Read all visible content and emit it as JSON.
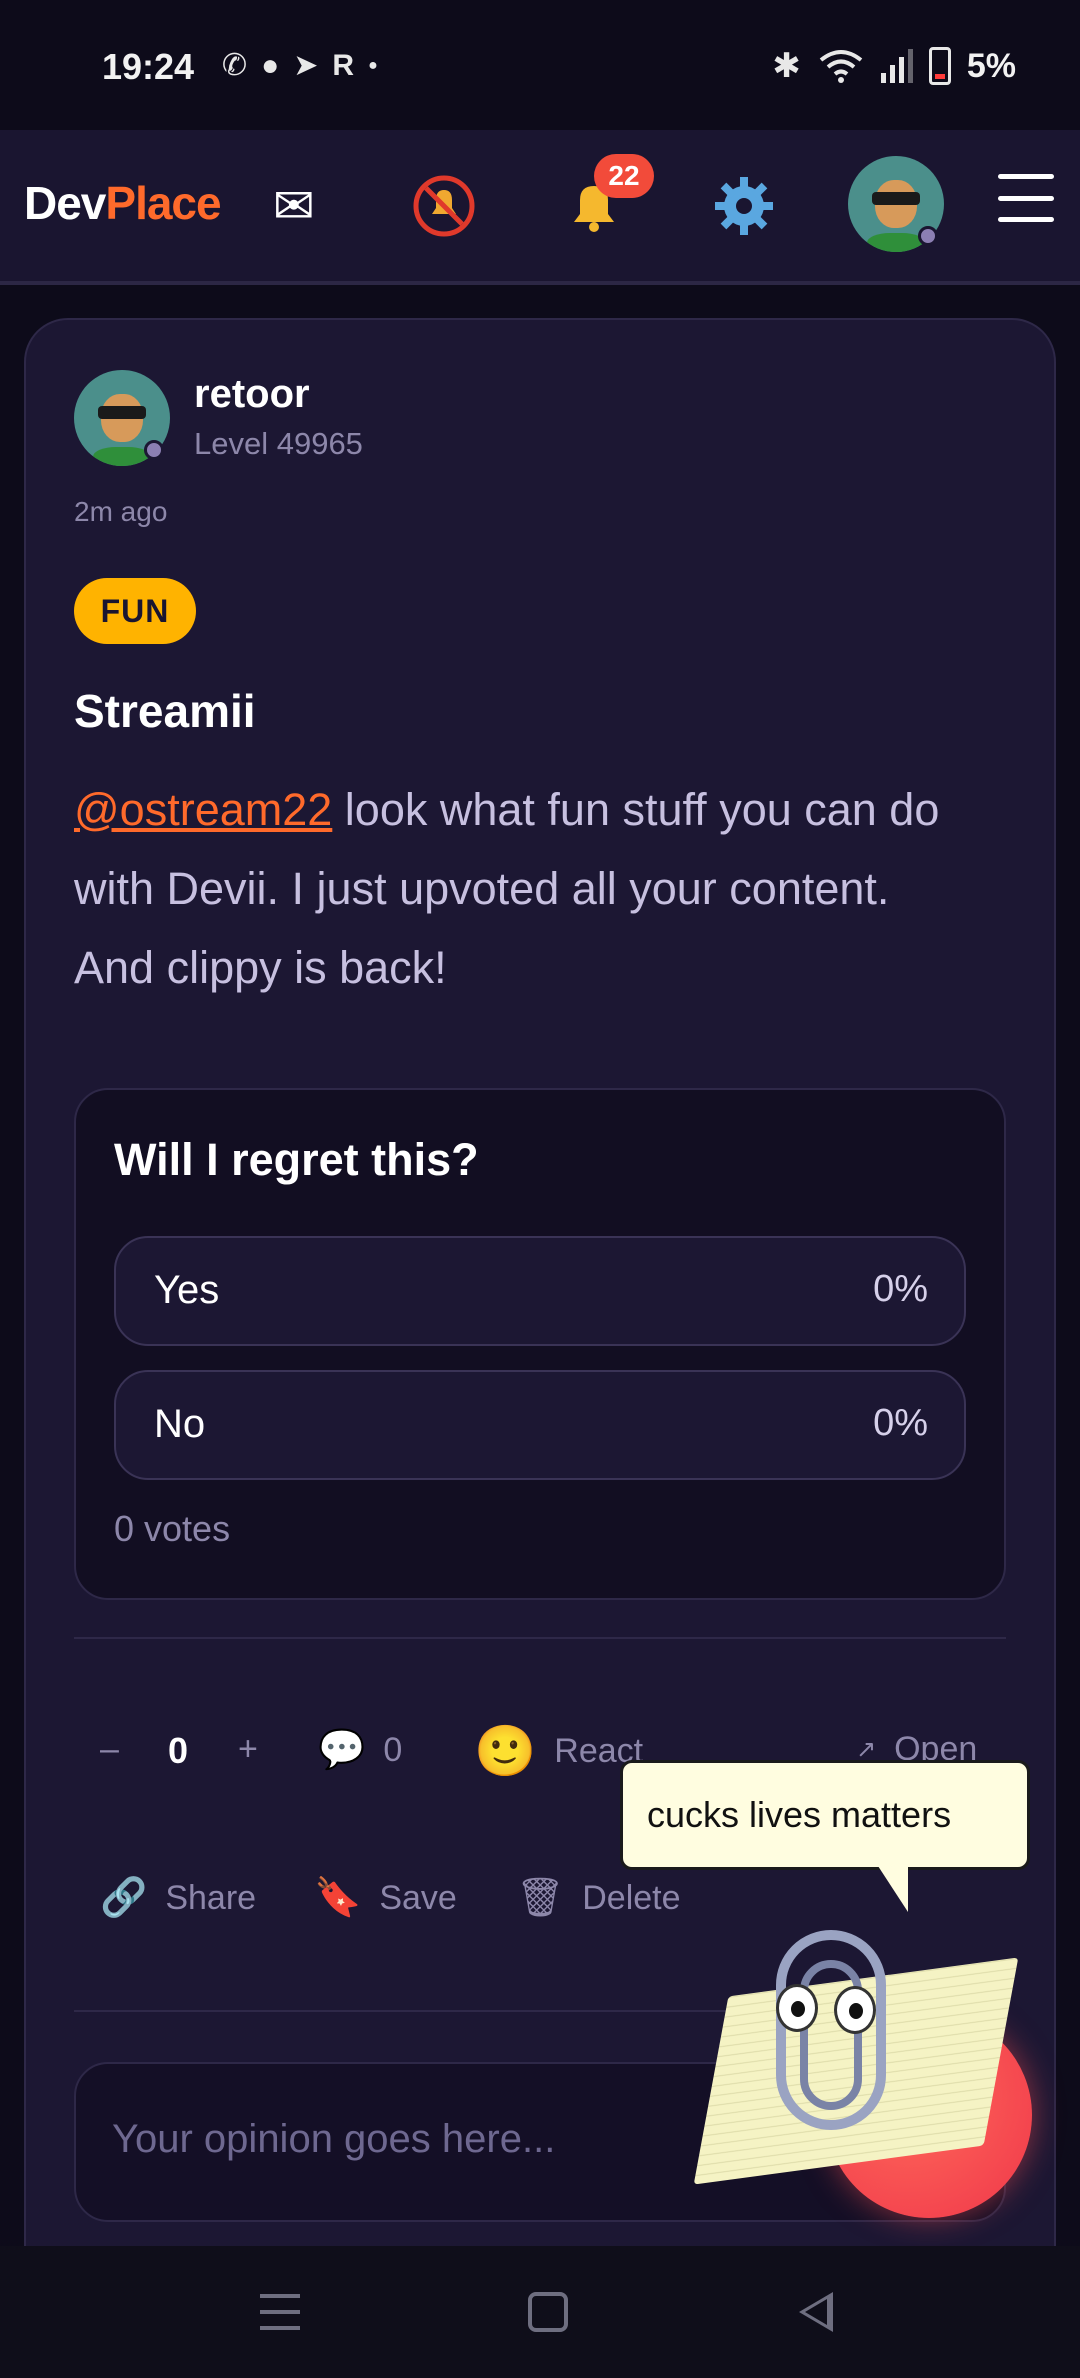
{
  "status_bar": {
    "time": "19:24",
    "app_icons": [
      "whatsapp-icon",
      "chat-icon",
      "telegram-icon",
      "r-icon",
      "dot-icon"
    ],
    "r_glyph": "R",
    "battery": "5%",
    "icons": [
      "bluetooth-icon",
      "wifi-icon",
      "signal-icon",
      "battery-icon"
    ]
  },
  "header": {
    "logo_part1": "Dev",
    "logo_part2": "Place",
    "notification_count": "22",
    "icons": [
      "mail-icon",
      "mute-notifications-icon",
      "bell-icon",
      "settings-gear-icon",
      "avatar",
      "hamburger-menu-icon"
    ],
    "accent": "#ff6a2b"
  },
  "post": {
    "username": "retoor",
    "level": "Level 49965",
    "time": "2m ago",
    "tag": "FUN",
    "title": "Streamii",
    "mention": "@ostream22",
    "body": " look what fun stuff you can do with Devii. I just upvoted all your content. And clippy is back!",
    "poll": {
      "question": "Will I regret this?",
      "options": [
        {
          "label": "Yes",
          "percent": "0%"
        },
        {
          "label": "No",
          "percent": "0%"
        }
      ],
      "votes": "0 votes"
    },
    "actions": {
      "downvote": "–",
      "score": "0",
      "upvote": "+",
      "comments": "0",
      "react": "React",
      "open": "Open",
      "share": "Share",
      "save": "Save",
      "delete": "Delete"
    },
    "comment_placeholder": "Your opinion goes here..."
  },
  "clippy": {
    "bubble": "cucks lives matters"
  },
  "colors": {
    "background": "#0d0b1a",
    "card": "#1c1733",
    "tag": "#ffb300",
    "badge": "#f24b3a"
  }
}
